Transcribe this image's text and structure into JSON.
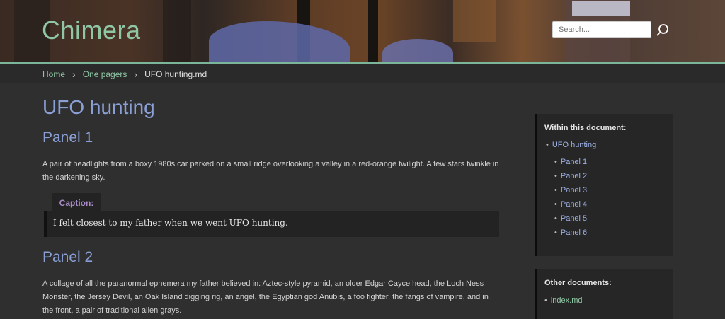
{
  "header": {
    "site_title": "Chimera",
    "search_placeholder": "Search..."
  },
  "breadcrumb": {
    "items": [
      "Home",
      "One pagers"
    ],
    "current": "UFO hunting.md"
  },
  "content": {
    "title": "UFO hunting",
    "panel1": {
      "heading": "Panel 1",
      "text": "A pair of headlights from a boxy 1980s car parked on a small ridge overlooking a valley in a red-orange twilight. A few stars twinkle in the darkening sky.",
      "caption_label": "Caption:",
      "caption_text": "I felt closest to my father when we went UFO hunting."
    },
    "panel2": {
      "heading": "Panel 2",
      "text": "A collage of all the paranormal ephemera my father believed in: Aztec-style pyramid, an older Edgar Cayce head, the Loch Ness Monster, the Jersey Devil, an Oak Island digging rig, an angel, the Egyptian god Anubis, a foo fighter, the fangs of vampire, and in the front, a pair of traditional alien grays."
    }
  },
  "sidebar": {
    "toc_title": "Within this document:",
    "toc_root": "UFO hunting",
    "toc_items": [
      "Panel 1",
      "Panel 2",
      "Panel 3",
      "Panel 4",
      "Panel 5",
      "Panel 6"
    ],
    "other_title": "Other documents:",
    "other_items": [
      "index.md"
    ]
  }
}
